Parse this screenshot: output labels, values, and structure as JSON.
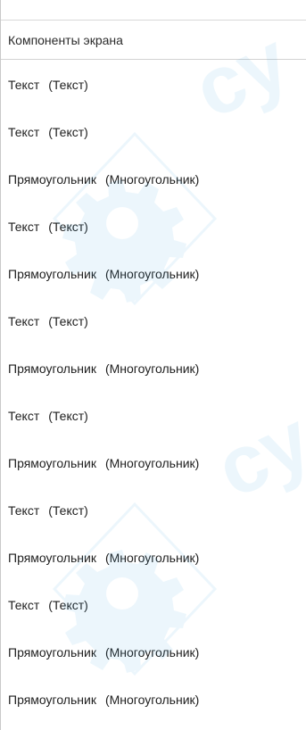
{
  "panel": {
    "title": "Компоненты экрана"
  },
  "components": [
    {
      "name": "Текст",
      "type": "(Текст)"
    },
    {
      "name": "Текст",
      "type": "(Текст)"
    },
    {
      "name": "Прямоугольник",
      "type": "(Многоугольник)"
    },
    {
      "name": "Текст",
      "type": "(Текст)"
    },
    {
      "name": "Прямоугольник",
      "type": "(Многоугольник)"
    },
    {
      "name": "Текст",
      "type": "(Текст)"
    },
    {
      "name": "Прямоугольник",
      "type": "(Многоугольник)"
    },
    {
      "name": "Текст",
      "type": "(Текст)"
    },
    {
      "name": "Прямоугольник",
      "type": "(Многоугольник)"
    },
    {
      "name": "Текст",
      "type": "(Текст)"
    },
    {
      "name": "Прямоугольник",
      "type": "(Многоугольник)"
    },
    {
      "name": "Текст",
      "type": "(Текст)"
    },
    {
      "name": "Прямоугольник",
      "type": "(Многоугольник)"
    },
    {
      "name": "Прямоугольник",
      "type": "(Многоугольник)"
    }
  ],
  "watermark": {
    "text": "cy",
    "color": "#36a6e0"
  }
}
